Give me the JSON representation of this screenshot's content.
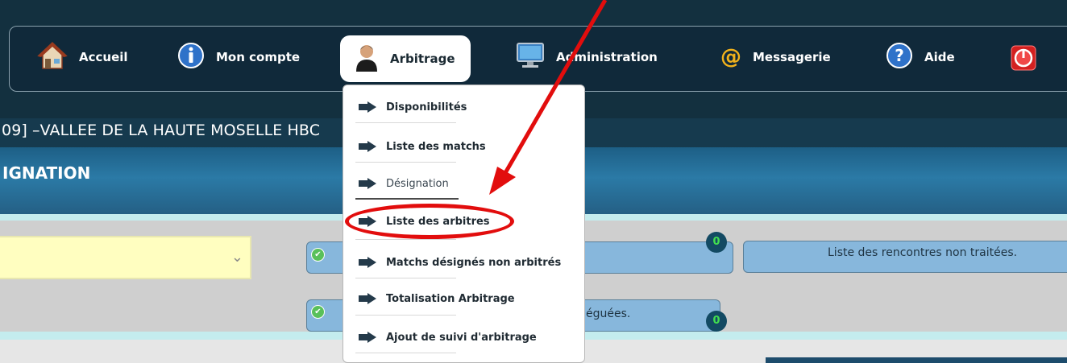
{
  "nav": {
    "items": [
      {
        "label": "Accueil",
        "icon": "home-icon"
      },
      {
        "label": "Mon compte",
        "icon": "info-icon"
      },
      {
        "label": "Arbitrage",
        "icon": "user-icon"
      },
      {
        "label": "Administration",
        "icon": "monitor-icon"
      },
      {
        "label": "Messagerie",
        "icon": "at-icon"
      },
      {
        "label": "Aide",
        "icon": "help-icon"
      }
    ],
    "active": "Arbitrage",
    "power_icon": "power-icon"
  },
  "club_title": "09] –VALLEE DE LA HAUTE MOSELLE HBC",
  "section_title": "IGNATION",
  "dropdown": {
    "items": [
      {
        "label": "Disponibilités"
      },
      {
        "label": "Liste des matchs"
      },
      {
        "label": "Désignation"
      },
      {
        "label": "Liste des arbitres"
      },
      {
        "label": "Matchs désignés non arbitrés"
      },
      {
        "label": "Totalisation Arbitrage"
      },
      {
        "label": "Ajout de suivi d'arbitrage"
      }
    ]
  },
  "panels": {
    "right_label": "Liste des rencontres non traitées.",
    "left_partial": "éguées.",
    "badge_top": "0",
    "badge_bottom": "0"
  },
  "colors": {
    "nav_bg": "#10293a",
    "banner": "#2b7aa6",
    "annotation": "#e20d0d",
    "panel": "#87b7dc"
  }
}
